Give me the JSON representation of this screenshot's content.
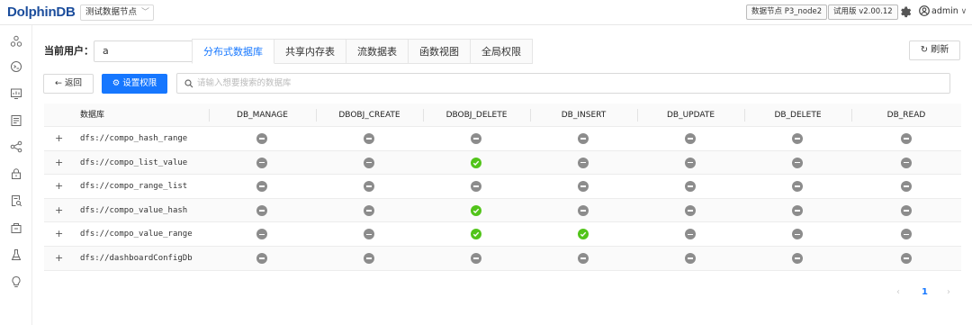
{
  "topbar": {
    "logo": "DolphinDB",
    "node_selector": "测试数据节点",
    "node_tag": "数据节点 P3_node2",
    "version_tag": "试用版 v2.00.12",
    "user": "admin"
  },
  "sidebar": {
    "icons": [
      "cluster-icon",
      "shell-icon",
      "dashboard-icon",
      "job-icon",
      "workflow-icon",
      "lock-icon",
      "doc-search-icon",
      "package-icon",
      "flask-icon",
      "bulb-icon"
    ]
  },
  "controls": {
    "current_user_label": "当前用户：",
    "current_user_value": "a",
    "tabs": [
      "分布式数据库",
      "共享内存表",
      "流数据表",
      "函数视图",
      "全局权限"
    ],
    "active_tab": 0,
    "refresh_label": "刷新",
    "back_label": "返回",
    "set_perm_label": "设置权限",
    "search_placeholder": "请输入想要搜索的数据库"
  },
  "table": {
    "columns": [
      "数据库",
      "DB_MANAGE",
      "DBOBJ_CREATE",
      "DBOBJ_DELETE",
      "DB_INSERT",
      "DB_UPDATE",
      "DB_DELETE",
      "DB_READ"
    ],
    "expand_symbol": "+",
    "rows": [
      {
        "name": "dfs://compo_hash_range",
        "perms": [
          "deny",
          "deny",
          "deny",
          "deny",
          "deny",
          "deny",
          "deny"
        ]
      },
      {
        "name": "dfs://compo_list_value",
        "perms": [
          "deny",
          "deny",
          "allow",
          "deny",
          "deny",
          "deny",
          "deny"
        ]
      },
      {
        "name": "dfs://compo_range_list",
        "perms": [
          "deny",
          "deny",
          "deny",
          "deny",
          "deny",
          "deny",
          "deny"
        ]
      },
      {
        "name": "dfs://compo_value_hash",
        "perms": [
          "deny",
          "deny",
          "allow",
          "deny",
          "deny",
          "deny",
          "deny"
        ]
      },
      {
        "name": "dfs://compo_value_range",
        "perms": [
          "deny",
          "deny",
          "allow",
          "allow",
          "deny",
          "deny",
          "deny"
        ]
      },
      {
        "name": "dfs://dashboardConfigDb",
        "perms": [
          "deny",
          "deny",
          "deny",
          "deny",
          "deny",
          "deny",
          "deny"
        ]
      }
    ]
  },
  "pagination": {
    "prev": "‹",
    "current": "1",
    "next": "›"
  },
  "colors": {
    "primary": "#1677ff",
    "allow": "#52c41a",
    "deny": "#8c8c8c"
  }
}
